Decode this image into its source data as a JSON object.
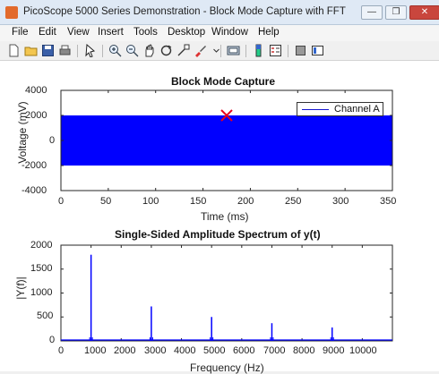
{
  "window": {
    "title": "PicoScope 5000 Series Demonstration - Block Mode Capture with FFT",
    "minimize": "—",
    "maximize": "❐",
    "close": "✕"
  },
  "menu": [
    "File",
    "Edit",
    "View",
    "Insert",
    "Tools",
    "Desktop",
    "Window",
    "Help"
  ],
  "toolbar": {
    "icons": [
      "new-figure-icon",
      "open-file-icon",
      "save-icon",
      "print-icon",
      "pointer-icon",
      "zoom-in-icon",
      "zoom-out-icon",
      "pan-icon",
      "rotate-icon",
      "data-cursor-icon",
      "brush-icon",
      "link-icon",
      "colorbar-icon",
      "legend-icon",
      "hide-plot-tools-icon",
      "show-plot-tools-icon"
    ]
  },
  "colors": {
    "signal": "#0000ff",
    "marker": "#e8001c"
  },
  "chart_data": [
    {
      "type": "line",
      "title": "Block Mode Capture",
      "xlabel": "Time (ms)",
      "ylabel": "Voltage (mV)",
      "xlim": [
        0,
        350
      ],
      "ylim": [
        -4000,
        4000
      ],
      "xticks": [
        "0",
        "50",
        "100",
        "150",
        "200",
        "250",
        "300",
        "350"
      ],
      "yticks": [
        "4000",
        "2000",
        "0",
        "-2000",
        "-4000"
      ],
      "series": [
        {
          "name": "Channel A",
          "envelope_min": -2000,
          "envelope_max": 2000
        }
      ],
      "marker": {
        "x": 175,
        "y": 2000
      },
      "legend": "top-right"
    },
    {
      "type": "line",
      "title": "Single-Sided Amplitude Spectrum of y(t)",
      "xlabel": "Frequency (Hz)",
      "ylabel": "|Y(f)|",
      "xlim": [
        0,
        11000
      ],
      "ylim": [
        0,
        2000
      ],
      "xticks": [
        "0",
        "1000",
        "2000",
        "3000",
        "4000",
        "5000",
        "6000",
        "7000",
        "8000",
        "9000",
        "10000"
      ],
      "yticks": [
        "2000",
        "1500",
        "1000",
        "500",
        "0"
      ],
      "peaks": [
        {
          "x": 1000,
          "y": 1800
        },
        {
          "x": 3000,
          "y": 720
        },
        {
          "x": 5000,
          "y": 500
        },
        {
          "x": 7000,
          "y": 370
        },
        {
          "x": 9000,
          "y": 280
        }
      ]
    }
  ]
}
